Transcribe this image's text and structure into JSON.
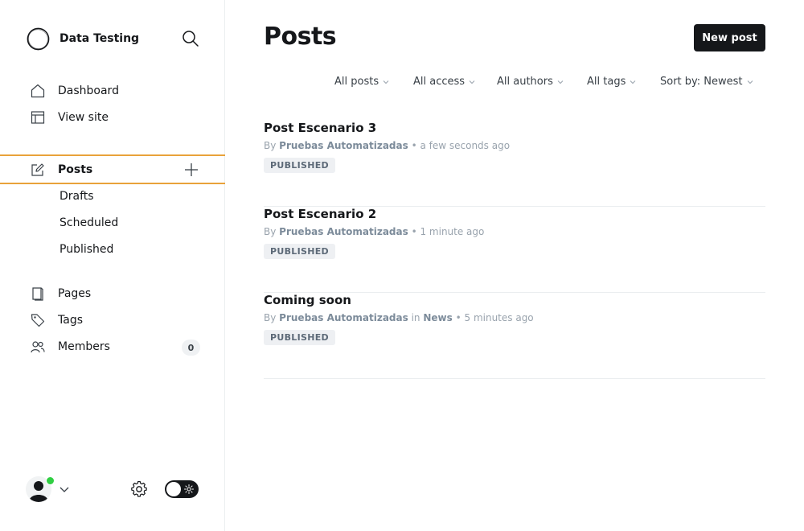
{
  "sidebar": {
    "brand_name": "Data Testing",
    "nav_top": [
      {
        "label": "Dashboard",
        "icon": "home-icon"
      },
      {
        "label": "View site",
        "icon": "layout-icon"
      }
    ],
    "posts": {
      "label": "Posts",
      "icon": "edit-icon"
    },
    "post_subitems": [
      {
        "label": "Drafts"
      },
      {
        "label": "Scheduled"
      },
      {
        "label": "Published"
      }
    ],
    "nav_bottom": [
      {
        "label": "Pages",
        "icon": "page-icon"
      },
      {
        "label": "Tags",
        "icon": "tag-icon"
      },
      {
        "label": "Members",
        "icon": "members-icon",
        "count": "0"
      }
    ]
  },
  "main": {
    "title": "Posts",
    "new_post_label": "New post",
    "filters": [
      "All posts",
      "All access",
      "All authors",
      "All tags",
      "Sort by: Newest"
    ],
    "posts": [
      {
        "title": "Post Escenario 3",
        "by": "By",
        "author": "Pruebas Automatizadas",
        "in": "",
        "tag": "",
        "time": "• a few seconds ago",
        "status": "PUBLISHED"
      },
      {
        "title": "Post Escenario 2",
        "by": "By",
        "author": "Pruebas Automatizadas",
        "in": "",
        "tag": "",
        "time": "• 1 minute ago",
        "status": "PUBLISHED"
      },
      {
        "title": "Coming soon",
        "by": "By",
        "author": "Pruebas Automatizadas",
        "in": "in",
        "tag": "News",
        "time": "• 5 minutes ago",
        "status": "PUBLISHED"
      }
    ]
  },
  "colors": {
    "accent_outline": "#e9a23a",
    "primary_button": "#15171a",
    "online_dot": "#30cf43"
  }
}
